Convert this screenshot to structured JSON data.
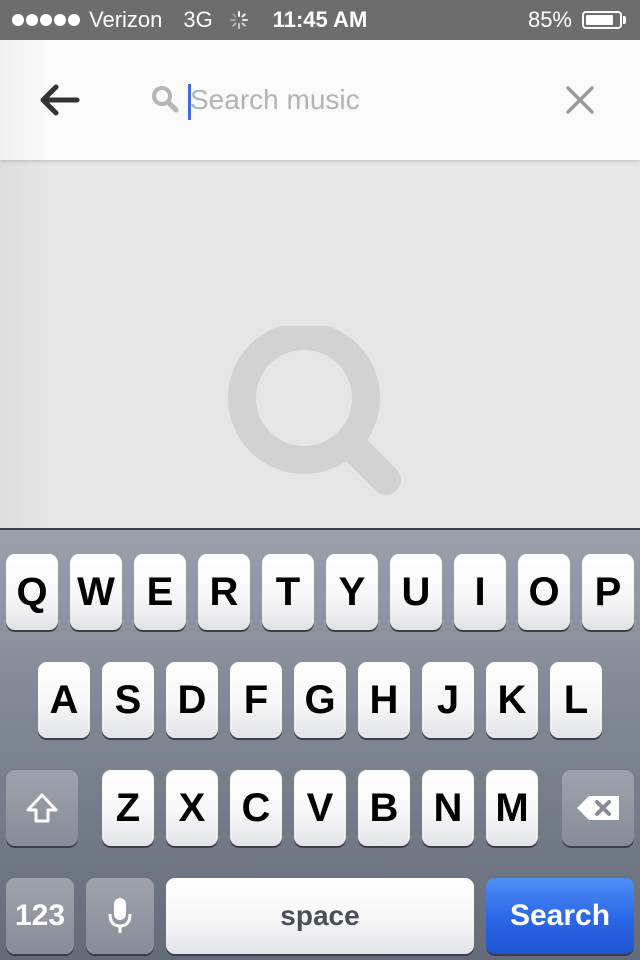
{
  "status_bar": {
    "carrier": "Verizon",
    "network": "3G",
    "time": "11:45 AM",
    "battery_percent": "85%",
    "battery_level": 0.85,
    "signal_bars": 5
  },
  "search": {
    "placeholder": "Search music",
    "value": ""
  },
  "keyboard": {
    "row1": [
      "Q",
      "W",
      "E",
      "R",
      "T",
      "Y",
      "U",
      "I",
      "O",
      "P"
    ],
    "row2": [
      "A",
      "S",
      "D",
      "F",
      "G",
      "H",
      "J",
      "K",
      "L"
    ],
    "row3": [
      "Z",
      "X",
      "C",
      "V",
      "B",
      "N",
      "M"
    ],
    "numbers_label": "123",
    "space_label": "space",
    "return_label": "Search"
  },
  "colors": {
    "status_bar": "#6d6d6d",
    "caret": "#3f6cd9",
    "search_key": "#2a66e6"
  },
  "icons": {
    "back": "arrow-left-icon",
    "search": "magnifier-icon",
    "clear": "close-icon",
    "shift": "shift-icon",
    "delete": "backspace-icon",
    "mic": "microphone-icon"
  }
}
